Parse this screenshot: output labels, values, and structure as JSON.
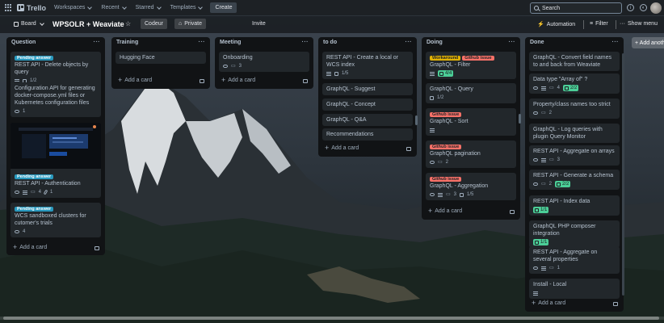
{
  "nav": {
    "logo": "Trello",
    "items": [
      "Workspaces",
      "Recent",
      "Starred",
      "Templates"
    ],
    "create": "Create",
    "search_placeholder": "Search"
  },
  "board": {
    "view": "Board",
    "title": "WPSOLR + Weaviate",
    "workspace": "Codeur",
    "visibility": "Private",
    "invite": "Invite",
    "automation": "Automation",
    "filter": "Filter",
    "show_menu": "Show menu",
    "add_another_list": "+ Add another list"
  },
  "add_card_label": "Add a card",
  "lists": {
    "question": {
      "title": "Question",
      "cards": [
        {
          "labels": [
            "Pending answer"
          ],
          "title": "REST API - Delete objects by query",
          "checklist": "1/2"
        },
        {
          "title": "Configuration API for generating docker-compose.yml files or Kubernetes configuration files",
          "watch": "1"
        },
        {
          "labels": [
            "Pending answer"
          ],
          "title": "REST API - Authentication",
          "comments": "4",
          "attachments": "1"
        },
        {
          "labels": [
            "Pending answer"
          ],
          "title": "WCS sandboxed clusters for cutomer's trials",
          "watch": "4"
        }
      ]
    },
    "training": {
      "title": "Training",
      "cards": [
        {
          "title": "Hugging Face"
        }
      ]
    },
    "meeting": {
      "title": "Meeting",
      "cards": [
        {
          "title": "Onboarding",
          "comments": "3"
        }
      ]
    },
    "todo": {
      "title": "to do",
      "cards": [
        {
          "title": "REST API - Create a local or WCS index",
          "checklist": "1/5"
        },
        {
          "title": "GraphQL - Suggest"
        },
        {
          "title": "GraphQL - Concept"
        },
        {
          "title": "GraphQL - Q&A"
        },
        {
          "title": "Recommendations"
        }
      ]
    },
    "doing": {
      "title": "Doing",
      "cards": [
        {
          "labels": [
            "Workaround",
            "Github issue"
          ],
          "title": "GraphQL - Filter",
          "checklist": "4/4"
        },
        {
          "title": "GraphQL - Query",
          "checklist": "1/2"
        },
        {
          "labels": [
            "Github issue"
          ],
          "title": "GraphQL - Sort"
        },
        {
          "labels": [
            "Github issue"
          ],
          "title": "GraphQL pagination",
          "comments": "2"
        },
        {
          "labels": [
            "Github issue"
          ],
          "title": "GraphQL - Aggregation",
          "comments": "3",
          "checklist": "1/5"
        }
      ]
    },
    "done": {
      "title": "Done",
      "cards": [
        {
          "title": "GraphQL - Convert field names to and back from Weaviate"
        },
        {
          "title": "Data type \"Array of\" ?",
          "comments": "4",
          "checklist": "2/2"
        },
        {
          "title": "Property/class names too strict",
          "comments": "2"
        },
        {
          "title": "GraphQL - Log queries with plugin Query Monitor"
        },
        {
          "title": "REST API - Aggregate on arrays",
          "comments": "3"
        },
        {
          "title": "REST API - Generate a schema",
          "comments": "2",
          "checklist": "2/2"
        },
        {
          "title": "REST API - Index data",
          "checklist": "1/1"
        },
        {
          "title": "GraphQL PHP composer integration",
          "checklist": "1/1"
        },
        {
          "title": "REST API - Aggregate on several properties",
          "comments": "1"
        },
        {
          "title": "Install - Local"
        }
      ]
    }
  },
  "colors": {
    "pending_answer": "#2898bd",
    "github_issue": "#f87168",
    "workaround": "#e2b203",
    "checklist_complete": "#4bce97"
  }
}
